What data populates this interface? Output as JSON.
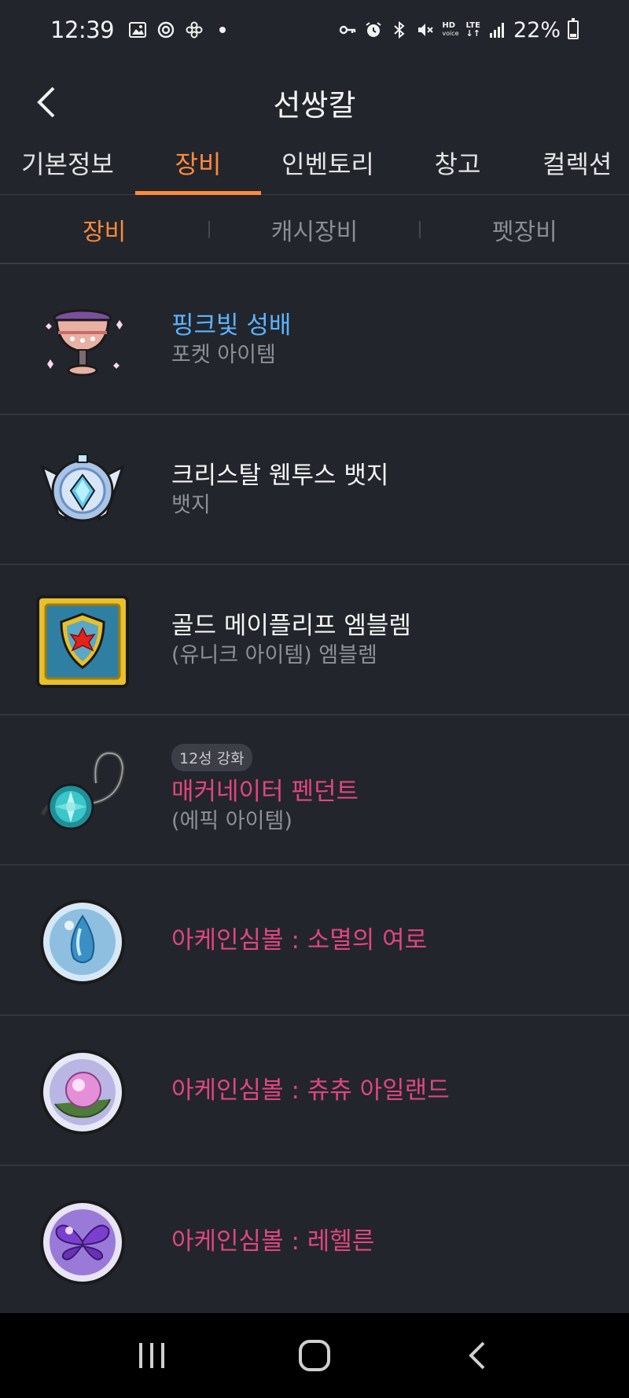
{
  "status_bar": {
    "time": "12:39",
    "battery_text": "22%",
    "battery_level": 0.22,
    "hd_label": "HD",
    "voice_label": "voice",
    "lte_label": "LTE"
  },
  "header": {
    "title": "선쌍칼"
  },
  "main_tabs": [
    {
      "label": "기본정보"
    },
    {
      "label": "장비"
    },
    {
      "label": "인벤토리"
    },
    {
      "label": "창고"
    },
    {
      "label": "컬렉션"
    }
  ],
  "sub_tabs": [
    {
      "label": "장비"
    },
    {
      "label": "캐시장비"
    },
    {
      "label": "펫장비"
    }
  ],
  "items": [
    {
      "name": "핑크빛 성배",
      "subtitle": "포켓 아이템",
      "icon": "pink-chalice-icon",
      "color": "#5db3ff"
    },
    {
      "name": "크리스탈 웬투스 뱃지",
      "subtitle": "뱃지",
      "icon": "crystal-badge-icon",
      "color": "#f5f5f5"
    },
    {
      "name": "골드 메이플리프 엠블렘",
      "subtitle": "(유니크 아이템) 엠블렘",
      "icon": "gold-emblem-icon",
      "color": "#f5f5f5"
    },
    {
      "name": "매커네이터 펜던트",
      "subtitle": "(에픽 아이템)",
      "badge": "12성 강화",
      "icon": "pendant-icon",
      "color": "#e0467e"
    },
    {
      "name": "아케인심볼 : 소멸의 여로",
      "icon": "arcane-symbol-blue-icon",
      "color": "#e0467e"
    },
    {
      "name": "아케인심볼 : 츄츄 아일랜드",
      "icon": "arcane-symbol-pink-icon",
      "color": "#e0467e"
    },
    {
      "name": "아케인심볼 : 레헬른",
      "icon": "arcane-symbol-purple-icon",
      "color": "#e0467e"
    }
  ],
  "colors": {
    "background": "#22252c",
    "accent": "#ff8a3c",
    "rare": "#5db3ff",
    "epic": "#e0467e"
  }
}
